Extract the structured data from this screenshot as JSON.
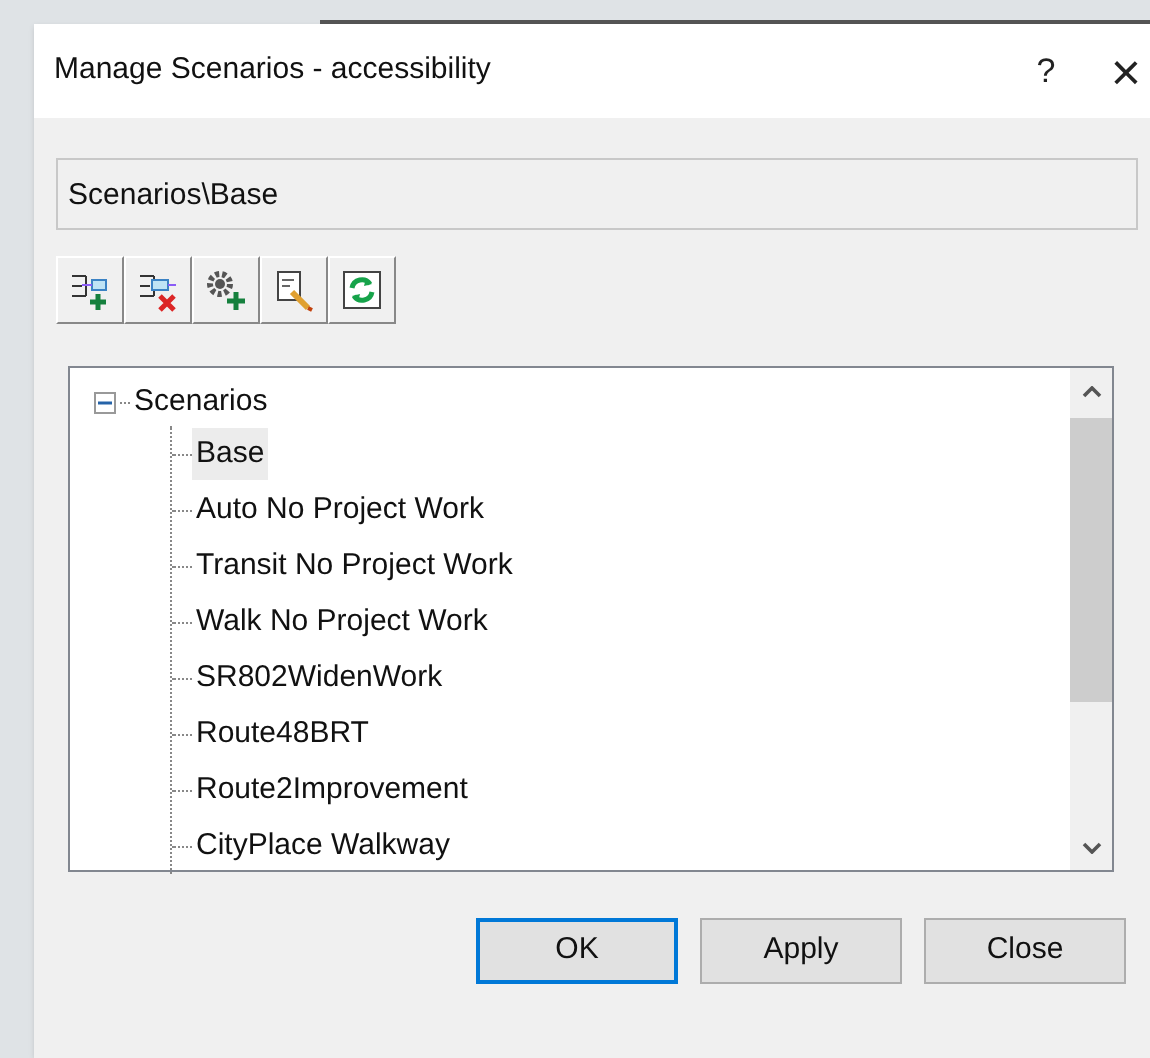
{
  "window": {
    "title": "Manage Scenarios - accessibility",
    "help": "?",
    "close": "×"
  },
  "path": {
    "value": "Scenarios\\Base"
  },
  "toolbar": [
    {
      "kind": "add"
    },
    {
      "kind": "delete"
    },
    {
      "kind": "settings"
    },
    {
      "kind": "edit"
    },
    {
      "kind": "refresh"
    }
  ],
  "tree": {
    "label": "Scenarios",
    "expanded": true,
    "children": [
      {
        "label": "Base",
        "selected": true
      },
      {
        "label": "Auto No Project Work",
        "selected": false
      },
      {
        "label": "Transit No Project Work",
        "selected": false
      },
      {
        "label": "Walk No Project Work",
        "selected": false
      },
      {
        "label": "SR802WidenWork",
        "selected": false
      },
      {
        "label": "Route48BRT",
        "selected": false
      },
      {
        "label": "Route2Improvement",
        "selected": false
      },
      {
        "label": "CityPlace Walkway",
        "selected": false
      }
    ]
  },
  "buttons": [
    {
      "label": "OK",
      "default": true
    },
    {
      "label": "Apply",
      "default": false
    },
    {
      "label": "Close",
      "default": false
    }
  ]
}
